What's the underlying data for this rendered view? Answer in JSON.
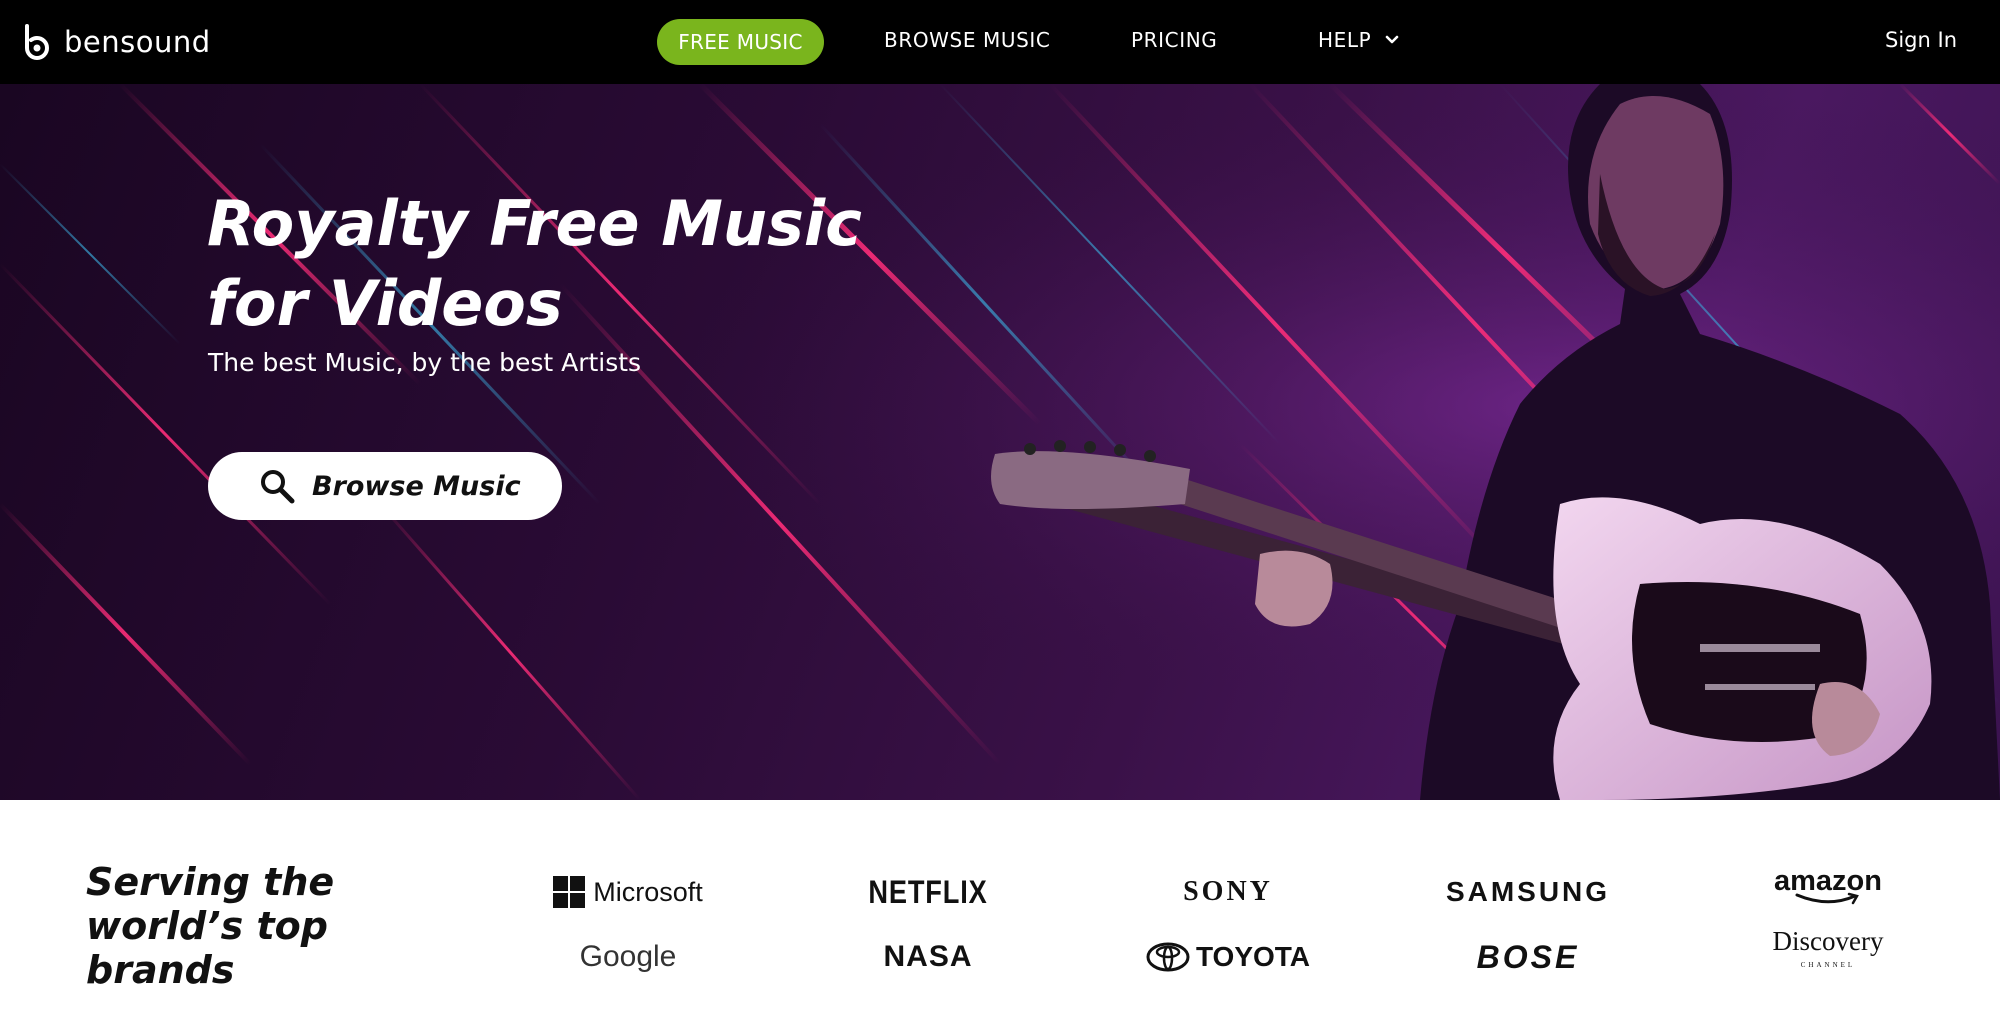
{
  "nav": {
    "logo_text": "bensound",
    "free_music": "FREE MUSIC",
    "browse_music": "BROWSE MUSIC",
    "pricing": "PRICING",
    "help": "HELP",
    "sign_in": "Sign In",
    "accent_color": "#7ab51d"
  },
  "hero": {
    "title_line1": "Royalty Free Music",
    "title_line2": "for Videos",
    "subtitle": "The best Music, by the best Artists",
    "browse_button": "Browse Music"
  },
  "brands": {
    "heading_line1": "Serving the",
    "heading_line2": "world’s top",
    "heading_line3": "brands",
    "logos": {
      "microsoft": "Microsoft",
      "netflix": "NETFLIX",
      "sony": "SONY",
      "samsung": "SAMSUNG",
      "amazon": "amazon",
      "google": "Google",
      "nasa": "NASA",
      "toyota": "TOYOTA",
      "bose": "BOSE",
      "discovery": "Discovery",
      "discovery_sub": "CHANNEL"
    }
  }
}
